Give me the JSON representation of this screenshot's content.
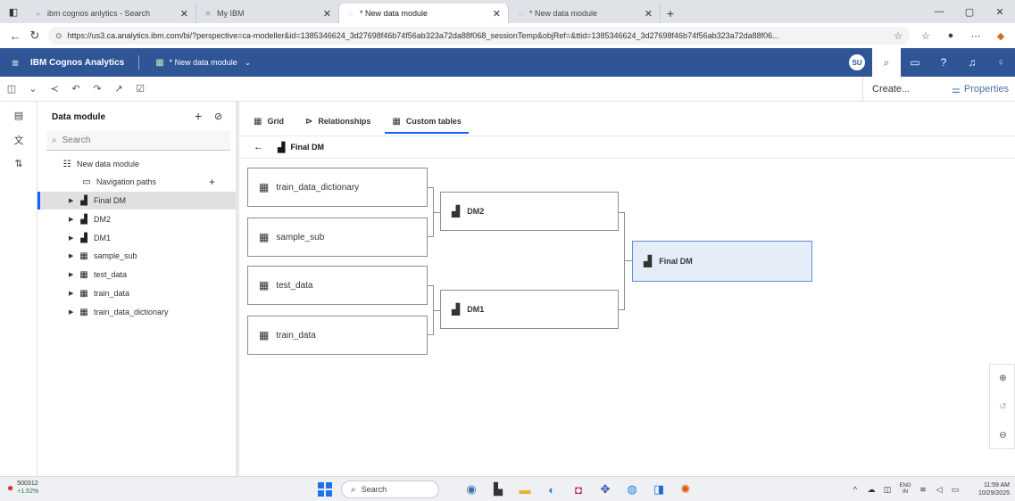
{
  "browser": {
    "tabs": [
      {
        "title": "ibm cognos anlytics - Search",
        "close": "✕"
      },
      {
        "title": "My IBM",
        "close": "✕"
      },
      {
        "title": "* New data module",
        "close": "✕"
      },
      {
        "title": "* New data module",
        "close": "✕"
      }
    ],
    "new_tab": "+",
    "url": "https://us3.ca.analytics.ibm.com/bi/?perspective=ca-modeller&id=1385346624_3d27698f46b74f56ab323a72da88f068_sessionTemp&objRef=&ttid=1385346624_3d27698f46b74f56ab323a72da88f06...",
    "window_controls": [
      "—",
      "▢",
      "✕"
    ]
  },
  "app": {
    "brand": "IBM Cognos Analytics",
    "module_title": "* New data module",
    "user_badge": "SU"
  },
  "toolbar": {
    "create_label": "Create...",
    "properties_label": "Properties"
  },
  "panel": {
    "title": "Data module",
    "search_placeholder": "Search",
    "root": "New data module",
    "items": [
      {
        "label": "Navigation paths"
      },
      {
        "label": "Final DM"
      },
      {
        "label": "DM2"
      },
      {
        "label": "DM1"
      },
      {
        "label": "sample_sub"
      },
      {
        "label": "test_data"
      },
      {
        "label": "train_data"
      },
      {
        "label": "train_data_dictionary"
      }
    ]
  },
  "main": {
    "tabs": [
      {
        "label": "Grid",
        "icon": "grid-icon"
      },
      {
        "label": "Relationships",
        "icon": "relationships-icon"
      },
      {
        "label": "Custom tables",
        "icon": "table-icon"
      }
    ],
    "breadcrumb": "Final DM",
    "diagram": {
      "inputs": [
        "train_data_dictionary",
        "sample_sub",
        "test_data",
        "train_data"
      ],
      "intermediate": [
        "DM2",
        "DM1"
      ],
      "output": "Final DM"
    }
  },
  "taskbar": {
    "ticker": "500312",
    "ticker_change": "+1.52%",
    "search_label": "Search",
    "lang_top": "ENG",
    "lang_bottom": "IN",
    "time": "11:59 AM",
    "date": "10/29/2025"
  }
}
